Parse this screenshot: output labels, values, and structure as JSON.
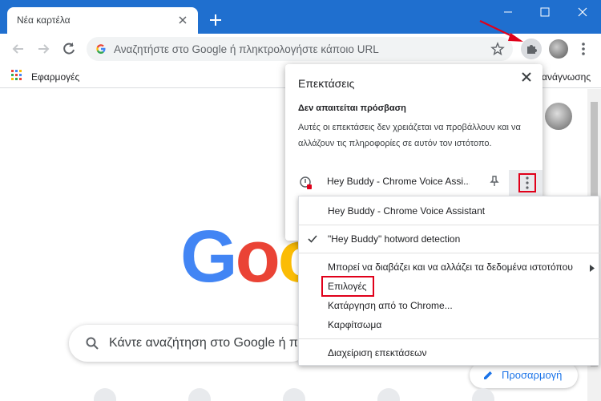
{
  "window": {
    "tab_title": "Νέα καρτέλα"
  },
  "toolbar": {
    "omnibox_placeholder": "Αναζητήστε στο Google ή πληκτρολογήστε κάποιο URL"
  },
  "bookmarks": {
    "apps_label": "Εφαρμογές",
    "right_label_partial": "ανάγνωσης"
  },
  "extensions_popup": {
    "title": "Επεκτάσεις",
    "section_title": "Δεν απαιτείται πρόσβαση",
    "section_description": "Αυτές οι επεκτάσεις δεν χρειάζεται να προβάλλουν και να αλλάζουν τις πληροφορίες σε αυτόν τον ιστότοπο.",
    "extension_name": "Hey Buddy - Chrome Voice Assi..."
  },
  "context_menu": {
    "items": [
      {
        "label": "Hey Buddy - Chrome Voice Assistant"
      },
      {
        "label": "\"Hey Buddy\" hotword detection",
        "checked": true
      },
      {
        "label": "Μπορεί να διαβάζει και να αλλάζει τα δεδομένα ιστοτόπου",
        "has_submenu": true
      },
      {
        "label": "Επιλογές"
      },
      {
        "label": "Κατάργηση από το Chrome..."
      },
      {
        "label": "Καρφίτσωμα"
      },
      {
        "label": "Διαχείριση επεκτάσεων"
      }
    ]
  },
  "page": {
    "logo_text": "Goo",
    "search_placeholder": "Κάντε αναζήτηση στο Google ή π",
    "customize_label": "Προσαρμογή"
  },
  "colors": {
    "titlebar": "#1f6fcf",
    "highlight_red": "#e0001a",
    "link_blue": "#1a73e8"
  }
}
